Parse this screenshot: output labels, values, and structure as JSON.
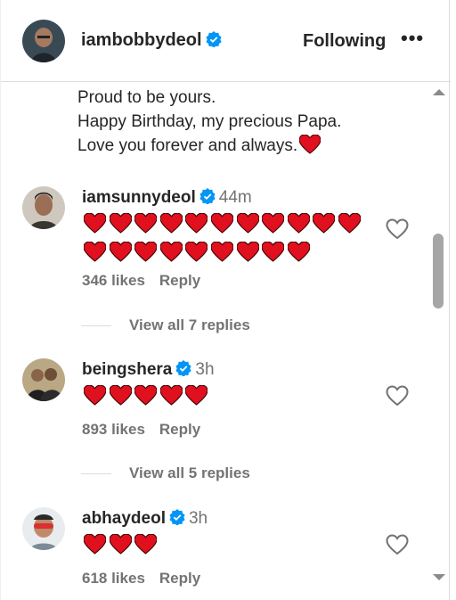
{
  "header": {
    "username": "iambobbydeol",
    "following_label": "Following",
    "more_label": "•••"
  },
  "caption": {
    "lines": [
      "Proud to be yours.",
      "Happy Birthday, my precious Papa.",
      "Love you forever and always."
    ]
  },
  "comments": [
    {
      "username": "iamsunnydeol",
      "time": "44m",
      "hearts": 20,
      "likes": "346 likes",
      "reply": "Reply",
      "view_replies": "View all 7 replies"
    },
    {
      "username": "beingshera",
      "time": "3h",
      "hearts": 5,
      "likes": "893 likes",
      "reply": "Reply",
      "view_replies": "View all 5 replies"
    },
    {
      "username": "abhaydeol",
      "time": "3h",
      "hearts": 3,
      "likes": "618 likes",
      "reply": "Reply"
    }
  ],
  "colors": {
    "verified": "#0095f6",
    "heart_emoji": "#e0101e",
    "muted_text": "#737373"
  },
  "icons": {
    "verified": "verified-badge-icon",
    "heart_emoji": "red-heart-emoji",
    "like": "heart-outline-icon"
  }
}
